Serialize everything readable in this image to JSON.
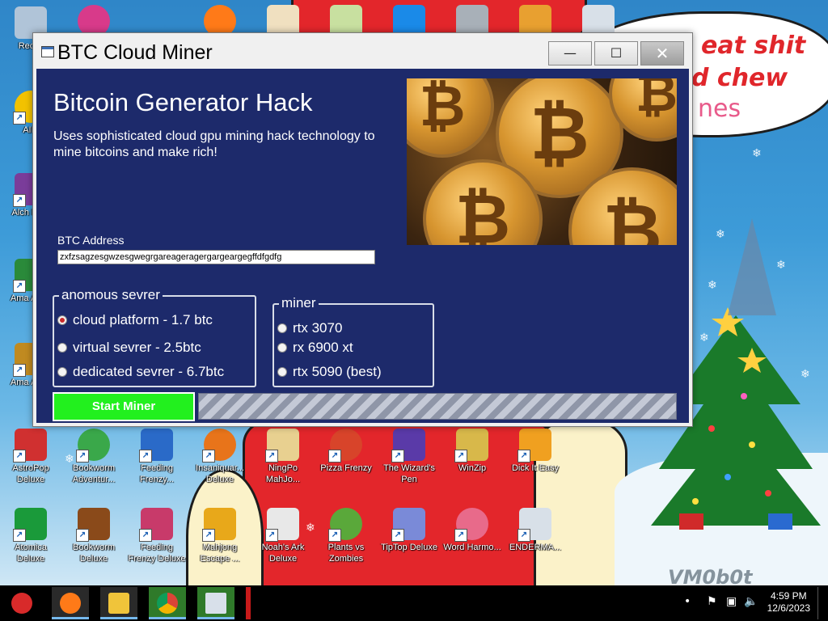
{
  "window": {
    "title": "BTC Cloud Miner",
    "minimize_glyph": "—",
    "maximize_glyph": "☐",
    "close_glyph": "✕",
    "heading": "Bitcoin Generator Hack",
    "description": "Uses sophisticated cloud gpu mining hack technology to mine bitcoins and make rich!",
    "address_label": "BTC Address",
    "address_value": "zxfzsagzesgwzesgwegrgareageragergargeargegffdfgdfg",
    "server_group": {
      "legend": "anomous sevrer",
      "options": [
        {
          "label": "cloud platform - 1.7 btc",
          "selected": true
        },
        {
          "label": "virtual sevrer - 2.5btc",
          "selected": false
        },
        {
          "label": "dedicated sevrer - 6.7btc",
          "selected": false
        }
      ]
    },
    "miner_group": {
      "legend": "miner",
      "options": [
        {
          "label": "rtx 3070",
          "selected": false
        },
        {
          "label": "rx 6900 xt",
          "selected": false
        },
        {
          "label": "rtx 5090 (best)",
          "selected": false
        }
      ]
    },
    "start_button": "Start Miner"
  },
  "background_text": {
    "speech_line1": "eat shit",
    "speech_line2": "d chew",
    "speech_line3": "nes",
    "watermark": "VM0b0t"
  },
  "desktop_icons": [
    {
      "label": "Recyc",
      "color": "#b0c4d8"
    },
    {
      "label": "AIM",
      "color": "#f2c200"
    },
    {
      "label": "Alch Delu",
      "color": "#7a3c9a"
    },
    {
      "label": "Ama Adve",
      "color": "#2a8a3a"
    },
    {
      "label": "Ama Adve",
      "color": "#c08a20"
    },
    {
      "label": "AstroPop Deluxe",
      "color": "#d03030"
    },
    {
      "label": "Bookworm Adventur...",
      "color": "#3aa84a"
    },
    {
      "label": "Feeding Frenzy...",
      "color": "#2a6ac8"
    },
    {
      "label": "Insaniquar... Deluxe",
      "color": "#e8741a"
    },
    {
      "label": "NingPo MahJo...",
      "color": "#e8d090"
    },
    {
      "label": "Pizza Frenzy",
      "color": "#d8442a"
    },
    {
      "label": "The Wizard's Pen",
      "color": "#5a3aa8"
    },
    {
      "label": "WinZip",
      "color": "#d8b84a"
    },
    {
      "label": "Dick It Easy",
      "color": "#f0a020"
    },
    {
      "label": "Atomica Deluxe",
      "color": "#1a9a3a"
    },
    {
      "label": "Bookworm Deluxe",
      "color": "#8a4a1a"
    },
    {
      "label": "Feeding Frenzy Deluxe",
      "color": "#c83a6a"
    },
    {
      "label": "Mahjong Escape ...",
      "color": "#e8a81a"
    },
    {
      "label": "Noah's Ark Deluxe",
      "color": "#e8e8e8"
    },
    {
      "label": "Plants vs Zombies",
      "color": "#5aa83a"
    },
    {
      "label": "TipTop Deluxe",
      "color": "#7a8ad8"
    },
    {
      "label": "Word Harmo...",
      "color": "#e86a8a"
    },
    {
      "label": "ENDERMA...",
      "color": "#d8e0e8"
    }
  ],
  "taskbar": {
    "items": [
      {
        "name": "start",
        "color": "#d82a2a"
      },
      {
        "name": "firefox",
        "color": "#ff7a18"
      },
      {
        "name": "file-explorer",
        "color": "#f0c43a"
      },
      {
        "name": "chrome",
        "color": "#4a9a3a"
      },
      {
        "name": "btc-miner-app",
        "color": "#d8e0ea"
      }
    ],
    "clock_time": "4:59 PM",
    "clock_date": "12/6/2023"
  }
}
